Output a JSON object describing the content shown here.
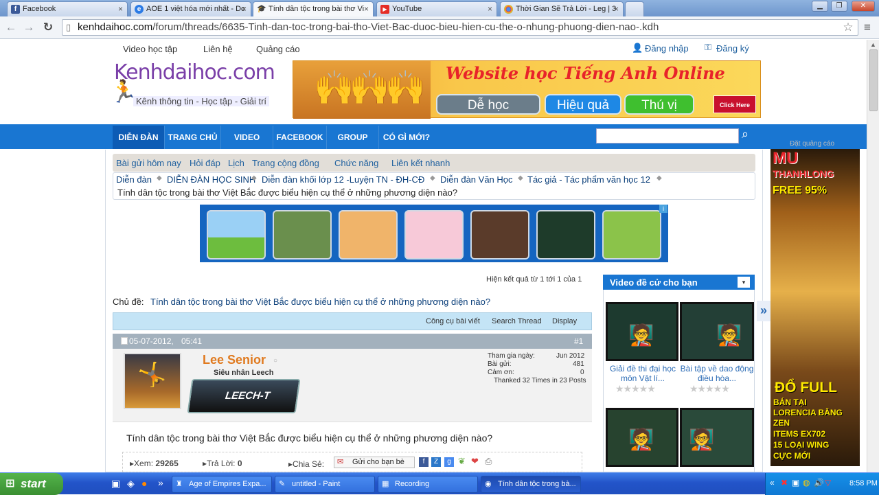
{
  "tabs": [
    {
      "label": "Facebook",
      "icon": "facebook-icon",
      "icon_char": "f",
      "icon_color": "#3b5998"
    },
    {
      "label": "AOE 1 việt hóa mới nhất - Dc",
      "icon": "globe-icon",
      "icon_char": "◎",
      "icon_color": "#2c7be5"
    },
    {
      "label": "Tính dân tộc trong bài thơ Vi",
      "icon": "grad-cap-icon",
      "icon_char": "▲",
      "icon_color": "#222"
    },
    {
      "label": "YouTube",
      "icon": "youtube-icon",
      "icon_char": "▶",
      "icon_color": "#e52d27"
    },
    {
      "label": "Thời Gian Sẽ Trả Lời - Leg | 3",
      "icon": "chrome-icon",
      "icon_char": "◉",
      "icon_color": "#4caf50"
    }
  ],
  "address": {
    "host": "kenhdaihoc.com",
    "path": "/forum/threads/6635-Tinh-dan-toc-trong-bai-tho-Viet-Bac-duoc-bieu-hien-cu-the-o-nhung-phuong-dien-nao-.kdh"
  },
  "toplinks": {
    "video": "Video học tập",
    "contact": "Liên hệ",
    "ads": "Quảng cáo",
    "login": "Đăng nhập",
    "register": "Đăng ký"
  },
  "logo": {
    "name": "Kenhdaihoc.com",
    "tagline": "Kênh thông tin - Học tập - Giải trí"
  },
  "banner": {
    "title": "Website học Tiếng Anh Online",
    "b1": "Dễ học",
    "b2": "Hiệu quả",
    "b3": "Thú vị",
    "click": "Click Here"
  },
  "nav": [
    "DIỄN ĐÀN",
    "TRANG CHỦ",
    "VIDEO",
    "FACEBOOK",
    "GROUP",
    "CÓ GÌ MỚI?"
  ],
  "subnav": [
    "Bài gửi hôm nay",
    "Hỏi đáp",
    "Lịch",
    "Trang cộng đồng",
    "Chức năng",
    "Liên kết nhanh"
  ],
  "breadcrumb": [
    "Diễn đàn",
    "DIỄN ĐÀN HỌC SINH",
    "Diễn đàn khối lớp 12 -Luyện TN - ĐH-CĐ",
    "Diễn đàn Văn Học",
    "Tác giả - Tác phẩm văn học 12"
  ],
  "thread_title": "Tính dân tộc trong bài thơ Việt Bắc được biểu hiện cụ thể ở những phương diện nào?",
  "results": "Hiện kết quả từ 1 tới 1 của 1",
  "subject_label": "Chủ đề:",
  "tools": {
    "a": "Công cụ bài viết",
    "b": "Search Thread",
    "c": "Display"
  },
  "post": {
    "date": "05-07-2012,",
    "time": "05:41",
    "num": "#1",
    "author": "Lee Senior",
    "rank": "Siêu nhân Leech",
    "badge": "LEECH-T",
    "join_label": "Tham gia ngày:",
    "join": "Jun 2012",
    "posts_label": "Bài gửi:",
    "posts": "481",
    "thanks_label": "Cảm ơn:",
    "thanks": "0",
    "thanked": "Thanked 32 Times in 23 Posts",
    "views_label": "Xem:",
    "views": "29265",
    "replies_label": "Trả Lời:",
    "replies": "0",
    "share": "Chia Sẻ:",
    "send": "Gửi cho bạn bè"
  },
  "video_box": {
    "title": "Video đề cử cho bạn",
    "v1": "Giải đề thi đại học môn Vật lí...",
    "v2": "Bài tập về dao động điều hòa..."
  },
  "side_ad": {
    "top_label": "Đặt quảng cáo",
    "line1": "MU",
    "line2": "THANHLONG",
    "line3": "FREE 95%",
    "line4": "ĐỔ FULL",
    "line5": "BÁN TẠI",
    "line6": "LORENCIA BẰNG",
    "line7": "ZEN",
    "line8": "ITEMS EX702",
    "line9": "15 LOẠI WING",
    "line10": "CỰC MỚI"
  },
  "taskbar": {
    "start": "start",
    "items": [
      "Age of Empires Expa...",
      "untitled - Paint",
      "Recording",
      "Tính dân tộc trong bà..."
    ],
    "clock": "8:58 PM"
  }
}
